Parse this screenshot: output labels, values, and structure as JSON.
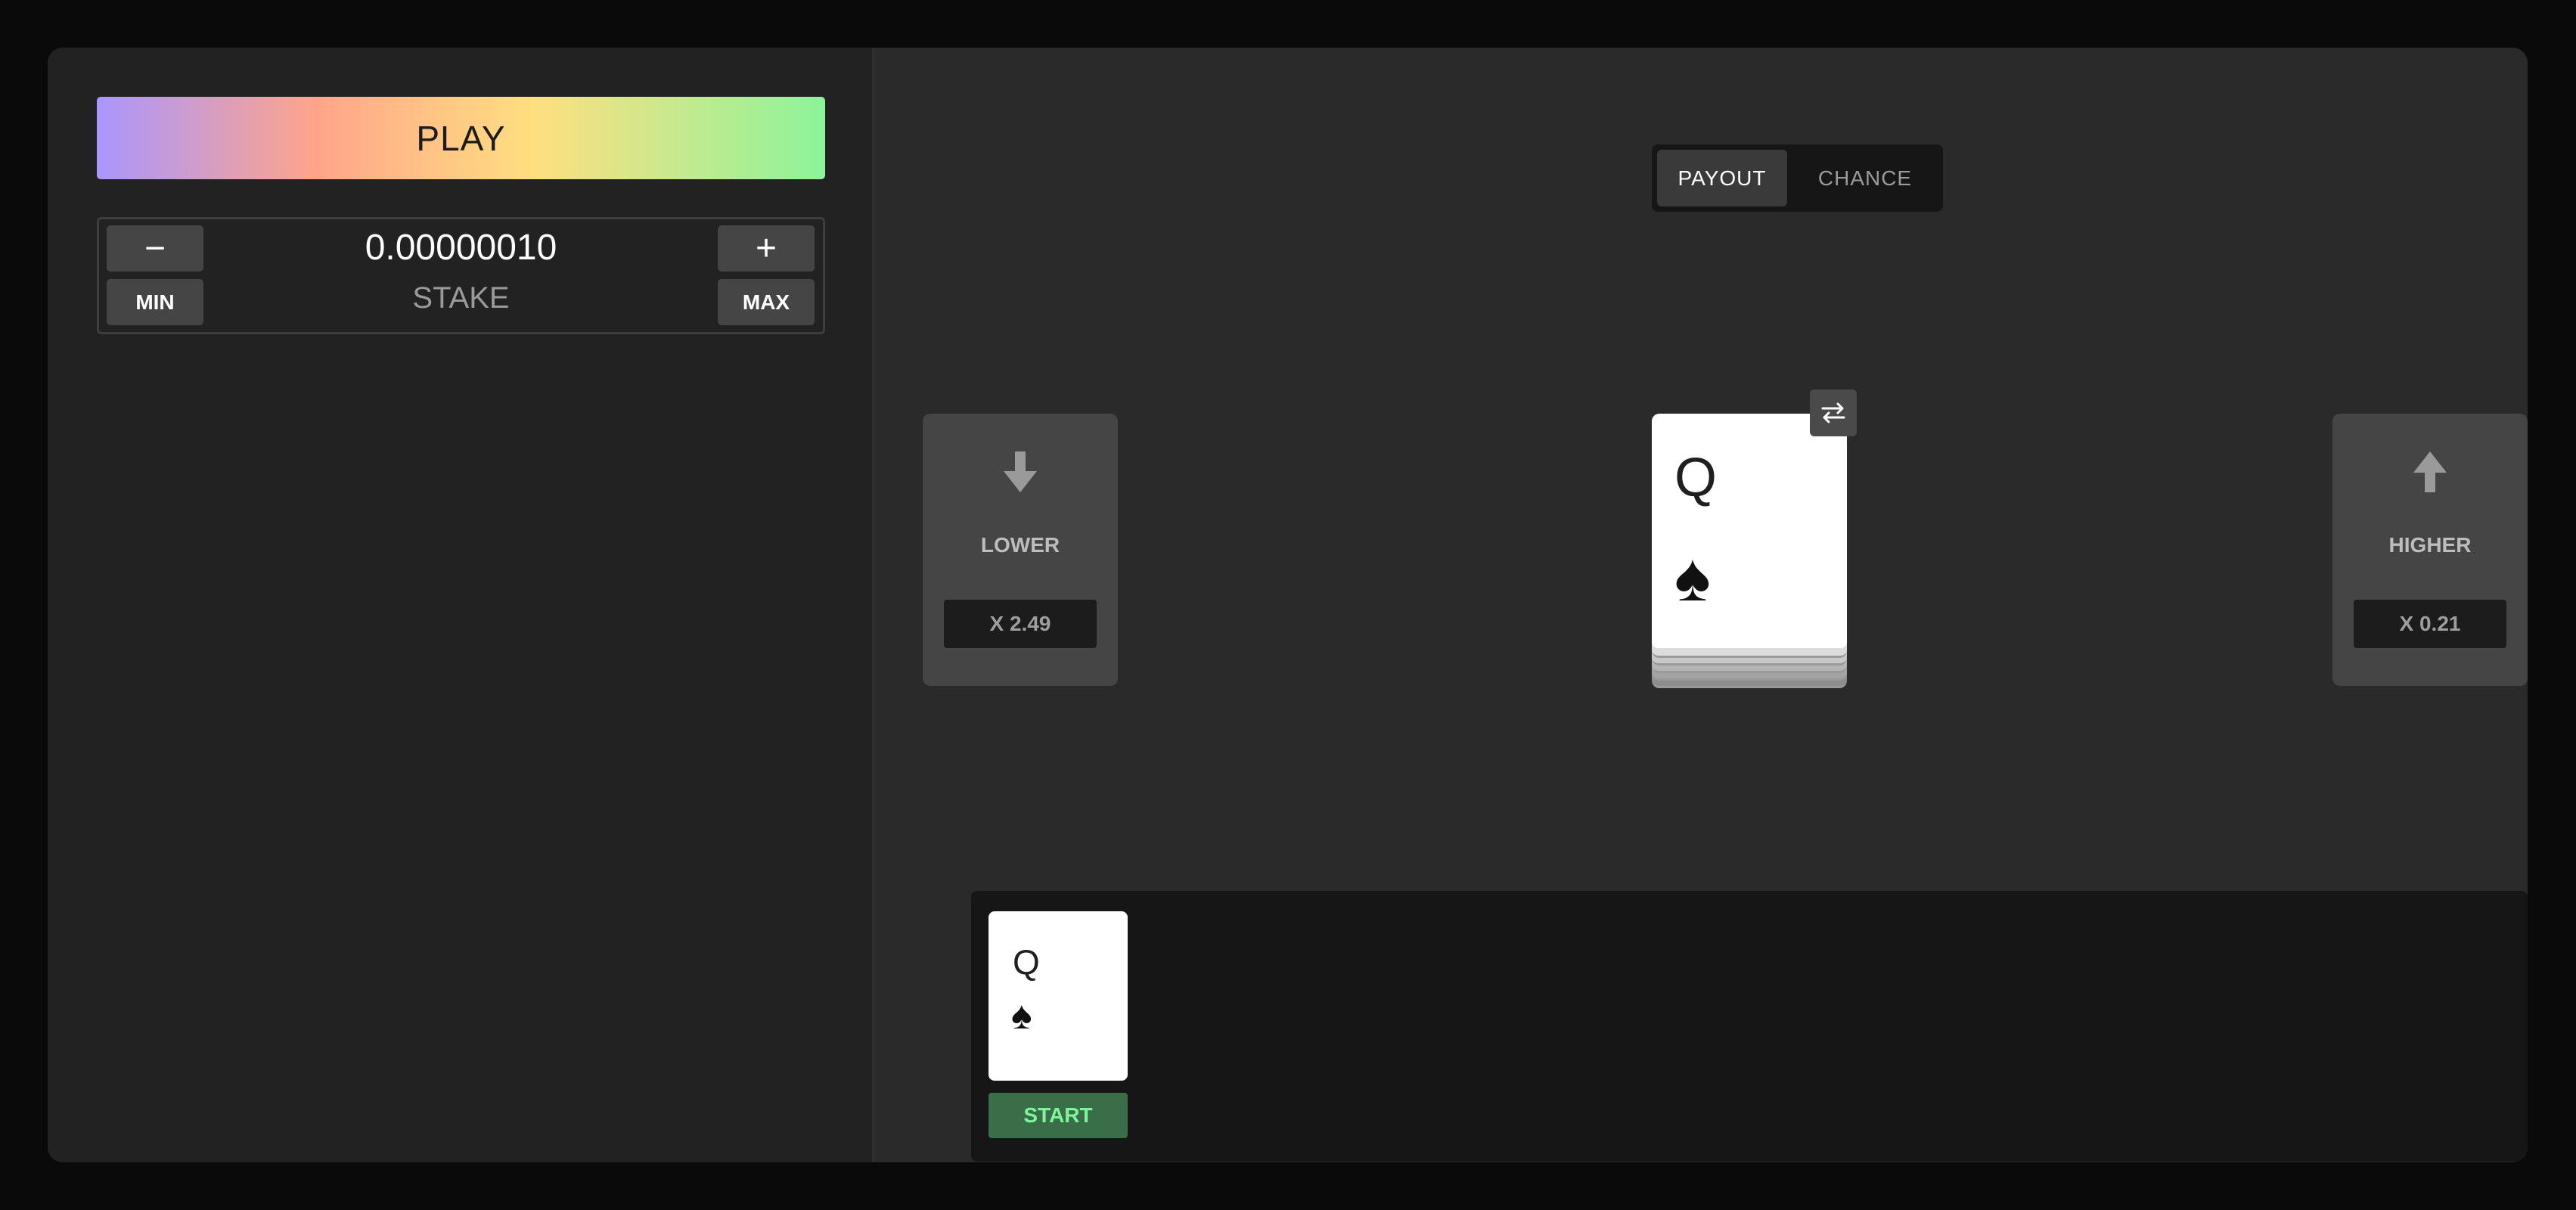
{
  "play": {
    "label": "PLAY"
  },
  "stake": {
    "minus": "−",
    "plus": "+",
    "min_label": "MIN",
    "max_label": "MAX",
    "value": "0.00000010",
    "label": "STAKE"
  },
  "mode_toggle": {
    "options": [
      {
        "label": "PAYOUT",
        "active": true
      },
      {
        "label": "CHANCE",
        "active": false
      }
    ]
  },
  "lower": {
    "icon": "arrow-down-icon",
    "label": "LOWER",
    "multiplier": "X 2.49"
  },
  "higher": {
    "icon": "arrow-up-icon",
    "label": "HIGHER",
    "multiplier": "X 0.21"
  },
  "current_card": {
    "rank": "Q",
    "suit": "♠",
    "swap_icon": "swap-icon"
  },
  "history": [
    {
      "rank": "Q",
      "suit": "♠",
      "label": "START",
      "label_color": "#7df59a"
    }
  ],
  "colors": {
    "accent_green": "#7df59a",
    "start_badge_bg": "#3a6e48"
  }
}
